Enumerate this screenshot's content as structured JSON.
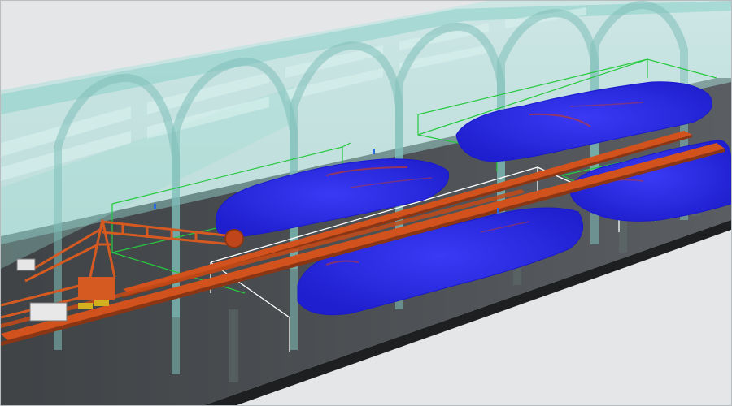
{
  "scene": {
    "description_labels": [],
    "colors": {
      "background": "#e4e6e8",
      "tunnel_glass": "#8fd3cc",
      "tunnel_rib": "#7fbfb9",
      "floor": "#4a4d50",
      "floor_edge": "#1e1f21",
      "stockpile": "#2828e6",
      "stockpile_highlight": "#c0392b",
      "conveyor": "#d2521e",
      "machine": "#d45a22",
      "bounding_box_green": "#27c93f",
      "bounding_box_white": "#ffffff"
    },
    "objects": {
      "stockpiles": [
        "stockpile-1",
        "stockpile-2",
        "stockpile-3",
        "stockpile-4"
      ],
      "conveyors": [
        "conveyor-upper",
        "conveyor-lower"
      ],
      "machine": "stacker-reclaimer"
    }
  }
}
